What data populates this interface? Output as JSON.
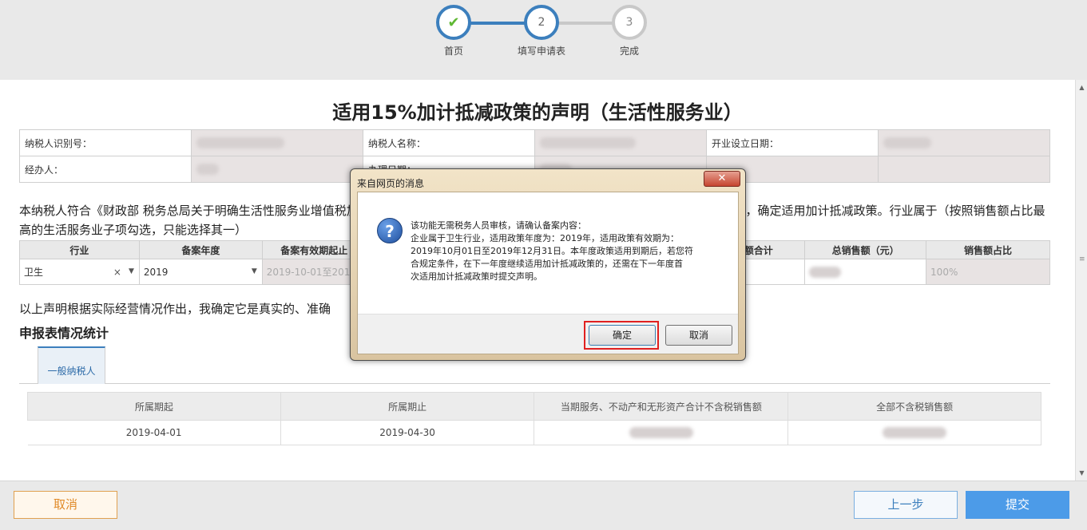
{
  "stepper": {
    "steps": [
      {
        "label": "首页",
        "mark": "✔"
      },
      {
        "label": "填写申请表",
        "mark": "2"
      },
      {
        "label": "完成",
        "mark": "3"
      }
    ]
  },
  "title": "适用15%加计抵减政策的声明（生活性服务业）",
  "info": {
    "taxpayer_id_label": "纳税人识别号：",
    "taxpayer_name_label": "纳税人名称：",
    "open_date_label": "开业设立日期：",
    "handler_label": "经办人：",
    "process_date_label": "办理日期："
  },
  "declaration": "本纳税人符合《财政部 税务总局关于明确生活性服务业增值税加计抵减政策的公告》（2019年第87号）规定的加计抵减政策适用所需条件，确定适用加计抵减政策。行业属于（按照销售额占比最高的生活服务业子项勾选，只能选择其一）",
  "industry_table": {
    "headers": [
      "行业",
      "备案年度",
      "备案有效期起止",
      "",
      "",
      "销售额合计",
      "总销售额（元）",
      "销售额占比"
    ],
    "row": {
      "industry": "卫生",
      "industry_clear": "×",
      "year": "2019",
      "period": "2019-10-01至2019",
      "ratio": "100%"
    }
  },
  "declaration2": "以上声明根据实际经营情况作出，我确定它是真实的、准确",
  "section_title": "申报表情况统计",
  "tab_label": "一般纳税人",
  "stat_table": {
    "headers": [
      "所属期起",
      "所属期止",
      "当期服务、不动产和无形资产合计不含税销售额",
      "全部不含税销售额"
    ],
    "rows": [
      {
        "start": "2019-04-01",
        "end": "2019-04-30"
      }
    ]
  },
  "footer": {
    "cancel": "取消",
    "prev": "上一步",
    "submit": "提交"
  },
  "dialog": {
    "title": "来自网页的消息",
    "close": "✕",
    "lines": [
      "该功能无需税务人员审核，请确认备案内容：",
      "企业属于卫生行业，适用政策年度为：2019年，适用政策有效期为：",
      "2019年10月01日至2019年12月31日。本年度政策适用到期后，若您符",
      "合规定条件，在下一年度继续适用加计抵减政策的，还需在下一年度首",
      "次适用加计抵减政策时提交声明。"
    ],
    "ok": "确定",
    "cancel": "取消"
  },
  "colors": {
    "accent": "#3c7fbd",
    "cancel_border": "#e0a050",
    "submit_bg": "#4c9be8",
    "highlight": "#e02020"
  }
}
